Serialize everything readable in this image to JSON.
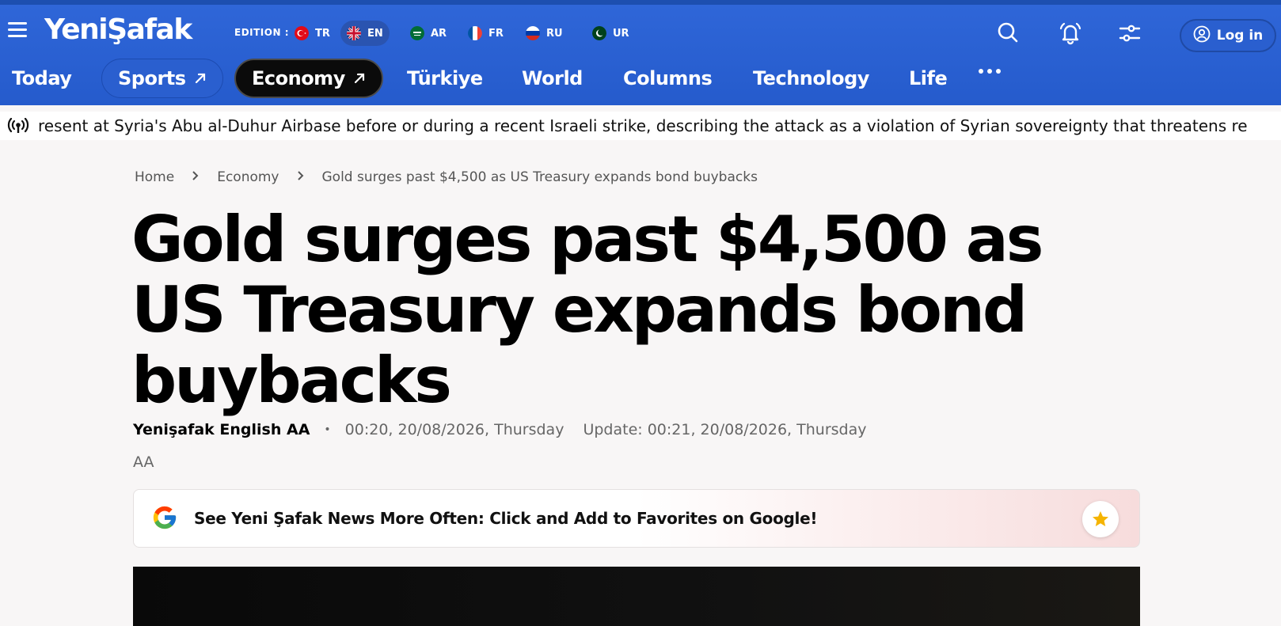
{
  "header": {
    "logo": "YeniŞafak",
    "edition_label": "EDITION :",
    "editions": [
      {
        "code": "TR",
        "flag": "turkey-flag",
        "active": false
      },
      {
        "code": "EN",
        "flag": "uk-flag",
        "active": true
      },
      {
        "code": "AR",
        "flag": "saudi-flag",
        "active": false
      },
      {
        "code": "FR",
        "flag": "france-flag",
        "active": false
      },
      {
        "code": "RU",
        "flag": "russia-flag",
        "active": false
      },
      {
        "code": "UR",
        "flag": "pakistan-flag",
        "active": false
      }
    ],
    "icons": [
      "search-icon",
      "bell-icon",
      "settings-sliders-icon",
      "user-icon"
    ],
    "login_label": "Log in",
    "brand_color": "#2f66d8"
  },
  "nav": {
    "items": [
      {
        "label": "Today"
      },
      {
        "label": "Sports",
        "external": true
      },
      {
        "label": "Economy",
        "external": true,
        "active": true
      },
      {
        "label": "Türkiye"
      },
      {
        "label": "World"
      },
      {
        "label": "Columns"
      },
      {
        "label": "Technology"
      },
      {
        "label": "Life"
      }
    ],
    "more_icon": "more-dots-icon"
  },
  "ticker": {
    "icon": "broadcast-icon",
    "text": "resent at Syria's Abu al-Duhur Airbase before or during a recent Israeli strike, describing the attack as a violation of Syrian sovereignty that threatens re"
  },
  "breadcrumb": [
    "Home",
    "Economy",
    "Gold surges past $4,500 as US Treasury expands bond buybacks"
  ],
  "article": {
    "headline": "Gold surges past $4,500 as US Treasury expands bond buybacks",
    "author": "Yenişafak English AA",
    "published": "00:20, 20/08/2026, Thursday",
    "updated": "Update: 00:21, 20/08/2026, Thursday",
    "font_size_label": "AA"
  },
  "google_promo": {
    "text": "See Yeni Şafak News More Often: Click and Add to Favorites on Google!",
    "icon": "google-icon",
    "star_icon": "star-icon"
  }
}
